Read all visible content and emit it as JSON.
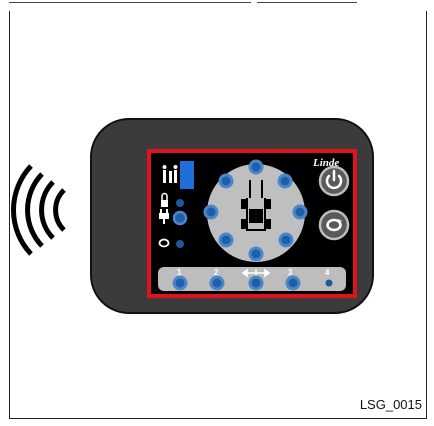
{
  "image_label": "LSG_0015",
  "brand": "Linde",
  "indicator_bar": {
    "numbers": [
      "1",
      "2",
      "3",
      "4"
    ]
  },
  "colors": {
    "device_body": "#3b3b3b",
    "screen_border": "#e0121b",
    "screen": "#000000",
    "dial": "#bfbfbf",
    "button_ring": "#4a86c8",
    "button_fill": "#1f5fa8",
    "accent_blue": "#1e6fd9",
    "bar": "#bdbdbd"
  },
  "icons": {
    "wireless": "wireless-signal-icon",
    "power": "power-icon",
    "cycle": "cycle-icon",
    "operator": "operator-icon",
    "drive_direction": "drive-direction-icon",
    "travel": "travel-icon"
  }
}
